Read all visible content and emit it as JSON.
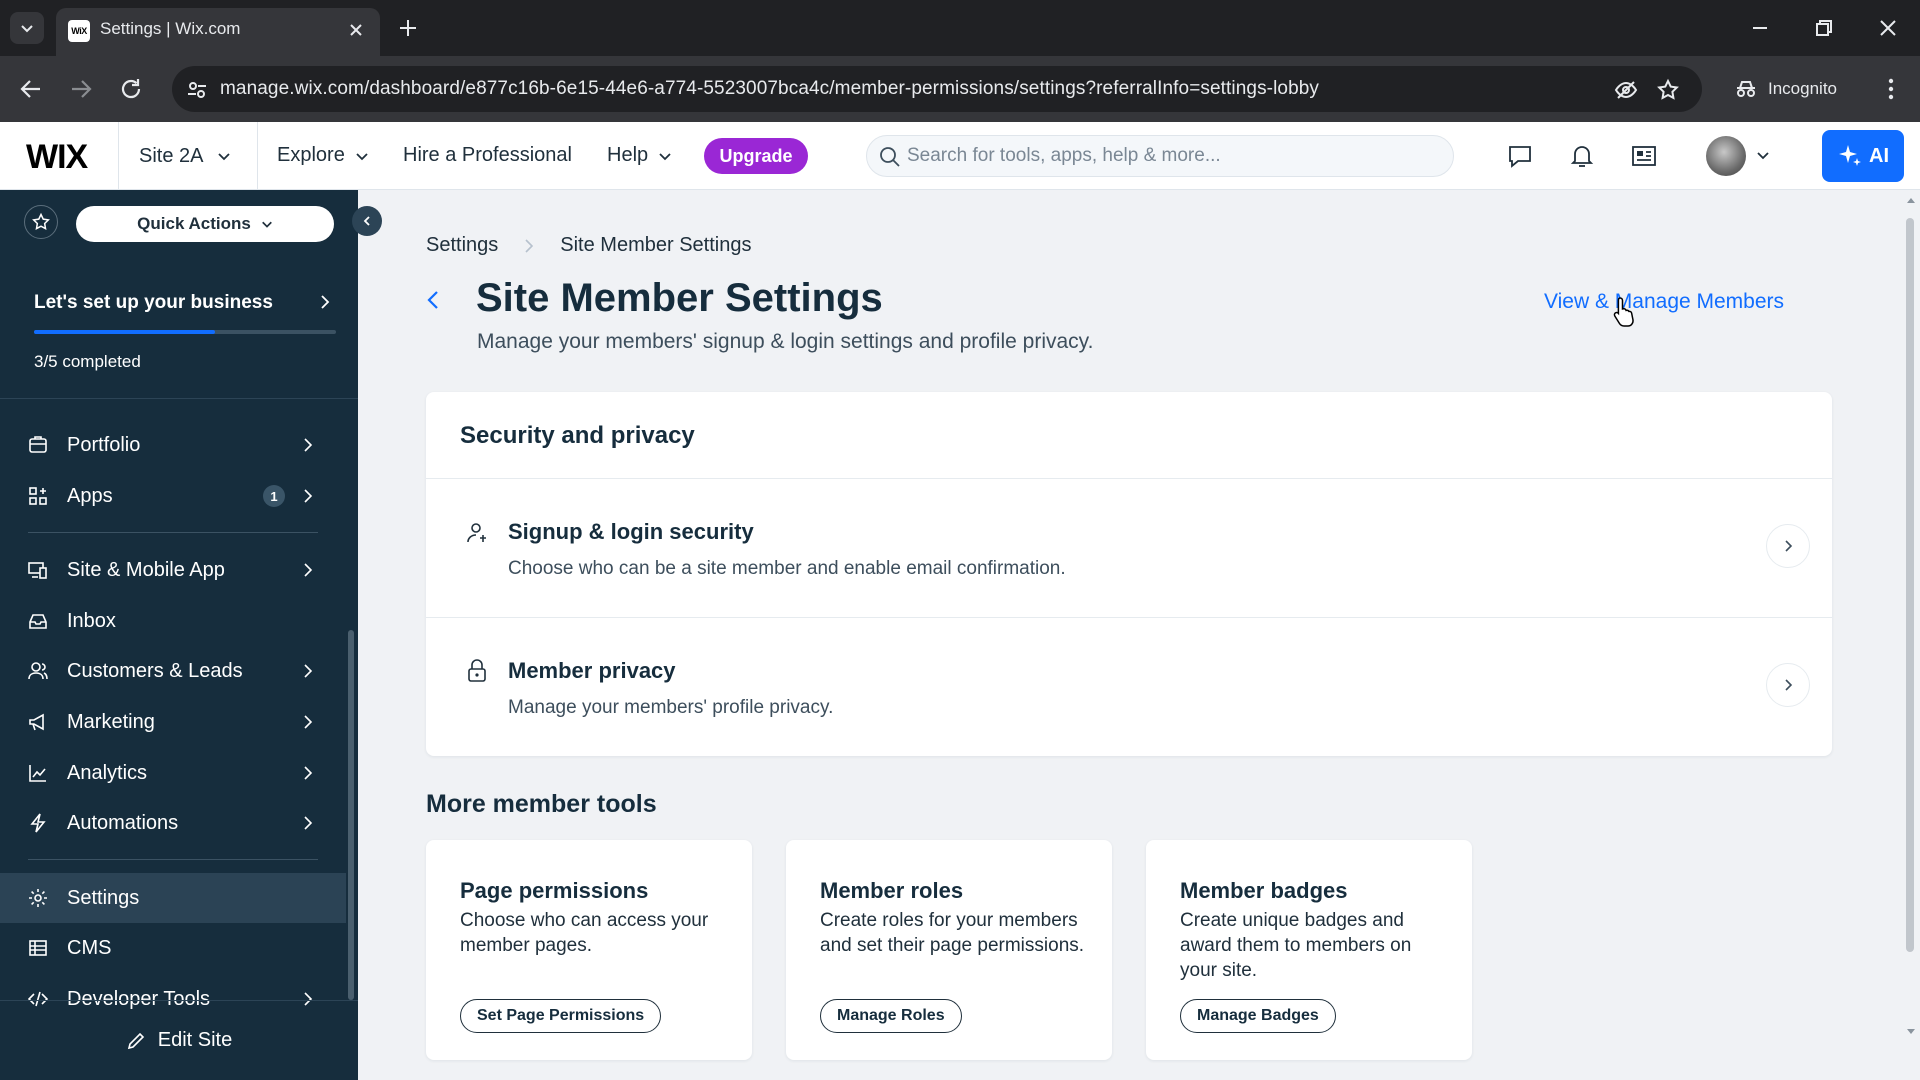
{
  "browser": {
    "tab_title": "Settings | Wix.com",
    "favicon_text": "WiX",
    "url": "manage.wix.com/dashboard/e877c16b-6e15-44e6-a774-5523007bca4c/member-permissions/settings?referralInfo=settings-lobby",
    "incognito_label": "Incognito"
  },
  "topbar": {
    "logo": "WIX",
    "site_name": "Site 2A",
    "explore": "Explore",
    "hire": "Hire a Professional",
    "help": "Help",
    "upgrade": "Upgrade",
    "search_placeholder": "Search for tools, apps, help & more...",
    "ai_label": "AI"
  },
  "sidebar": {
    "quick_actions": "Quick Actions",
    "setup_title": "Let's set up your business",
    "setup_progress": 0.6,
    "setup_completed": "3/5 completed",
    "items": [
      {
        "label": "Portfolio",
        "icon": "portfolio-icon"
      },
      {
        "label": "Apps",
        "icon": "apps-icon",
        "badge": "1"
      },
      {
        "label": "Site & Mobile App",
        "icon": "site-mobile-icon"
      },
      {
        "label": "Inbox",
        "icon": "inbox-icon"
      },
      {
        "label": "Customers & Leads",
        "icon": "customers-icon"
      },
      {
        "label": "Marketing",
        "icon": "marketing-icon"
      },
      {
        "label": "Analytics",
        "icon": "analytics-icon"
      },
      {
        "label": "Automations",
        "icon": "automations-icon"
      },
      {
        "label": "Settings",
        "icon": "gear-icon",
        "active": true
      },
      {
        "label": "CMS",
        "icon": "cms-icon"
      },
      {
        "label": "Developer Tools",
        "icon": "code-icon"
      }
    ],
    "edit_site": "Edit Site"
  },
  "main": {
    "breadcrumb": [
      "Settings",
      "Site Member Settings"
    ],
    "title": "Site Member Settings",
    "subtitle": "Manage your members' signup & login settings and profile privacy.",
    "view_manage": "View & Manage Members",
    "security": {
      "title": "Security and privacy",
      "rows": [
        {
          "title": "Signup & login security",
          "desc": "Choose who can be a site member and enable email confirmation."
        },
        {
          "title": "Member privacy",
          "desc": "Manage your members' profile privacy."
        }
      ]
    },
    "more_tools": {
      "title": "More member tools",
      "cards": [
        {
          "title": "Page permissions",
          "desc": "Choose who can access your member pages.",
          "button": "Set Page Permissions"
        },
        {
          "title": "Member roles",
          "desc": "Create roles for your members and set their page permissions.",
          "button": "Manage Roles"
        },
        {
          "title": "Member badges",
          "desc": "Create unique badges and award them to members on your site.",
          "button": "Manage Badges"
        }
      ]
    }
  },
  "colors": {
    "accent": "#116dff",
    "sidebar": "#162d3d",
    "upgrade": "#9a27d5"
  }
}
